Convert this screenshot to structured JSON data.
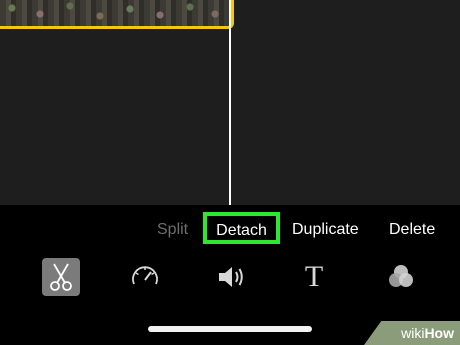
{
  "actions": {
    "split": "Split",
    "detach": "Detach",
    "duplicate": "Duplicate",
    "delete": "Delete"
  },
  "tools": [
    {
      "icon": "scissors-icon",
      "selected": true
    },
    {
      "icon": "speedometer-icon",
      "selected": false
    },
    {
      "icon": "speaker-icon",
      "selected": false
    },
    {
      "icon": "title-icon",
      "glyph": "T",
      "selected": false
    },
    {
      "icon": "filters-icon",
      "selected": false
    }
  ],
  "watermark": {
    "prefix": "wiki",
    "suffix": "How"
  },
  "colors": {
    "clip_border": "#f5c518",
    "highlight": "#2ee82e",
    "timeline_bg": "#1e1e1e",
    "toolbar_bg": "#000000"
  }
}
